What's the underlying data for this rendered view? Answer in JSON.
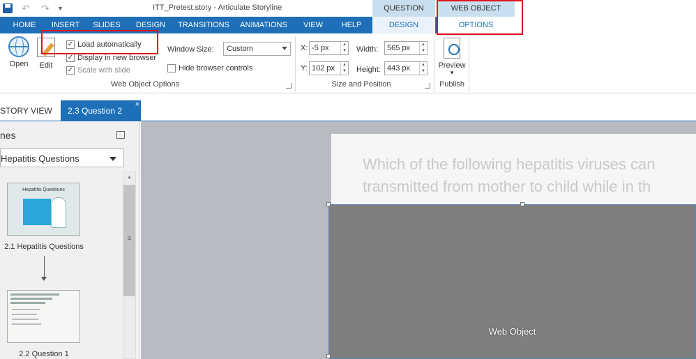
{
  "app": {
    "title": "ITT_Pretest.story -  Articulate Storyline",
    "qat_undo": "↶",
    "qat_redo": "↷",
    "qat_more": "▼"
  },
  "context_groups": {
    "question_tools": "QUESTION TOOLS",
    "web_object_tools": "WEB OBJECT TOOLS"
  },
  "tabs": [
    "HOME",
    "INSERT",
    "SLIDES",
    "DESIGN",
    "TRANSITIONS",
    "ANIMATIONS",
    "VIEW",
    "HELP"
  ],
  "context_tabs": {
    "design": "DESIGN",
    "options": "OPTIONS"
  },
  "ribbon": {
    "open_label": "Open",
    "edit_label": "Edit",
    "load_automatically": "Load automatically",
    "display_in_new_browser": "Display in new browser",
    "scale_with_slide": "Scale with slide",
    "window_size_label": "Window Size:",
    "window_size_value": "Custom",
    "hide_browser_controls": "Hide browser controls",
    "group_web_object_options": "Web Object Options",
    "x_label": "X:",
    "x_value": "-5 px",
    "y_label": "Y:",
    "y_value": "102 px",
    "width_label": "Width:",
    "width_value": "565 px",
    "height_label": "Height:",
    "height_value": "443 px",
    "group_size_position": "Size and Position",
    "preview_label": "Preview",
    "preview_arrow": "▾",
    "group_publish": "Publish",
    "checked_mark": "✓"
  },
  "doc_tabs": {
    "story_view": "STORY VIEW",
    "active": "2.3 Question 2",
    "close": "×"
  },
  "left_panel": {
    "title": "nes",
    "dropdown_value": "Hepatitis Questions",
    "thumb1_title": "Hepatitis Questions",
    "thumb1_caption": "2.1 Hepatitis Questions",
    "thumb2_caption": "2.2 Question 1",
    "scroll_grip": "≡"
  },
  "stage": {
    "question_line1": "Which of the following hepatitis viruses can",
    "question_line2": "transmitted from mother to child while in th",
    "web_object_label": "Web Object"
  }
}
